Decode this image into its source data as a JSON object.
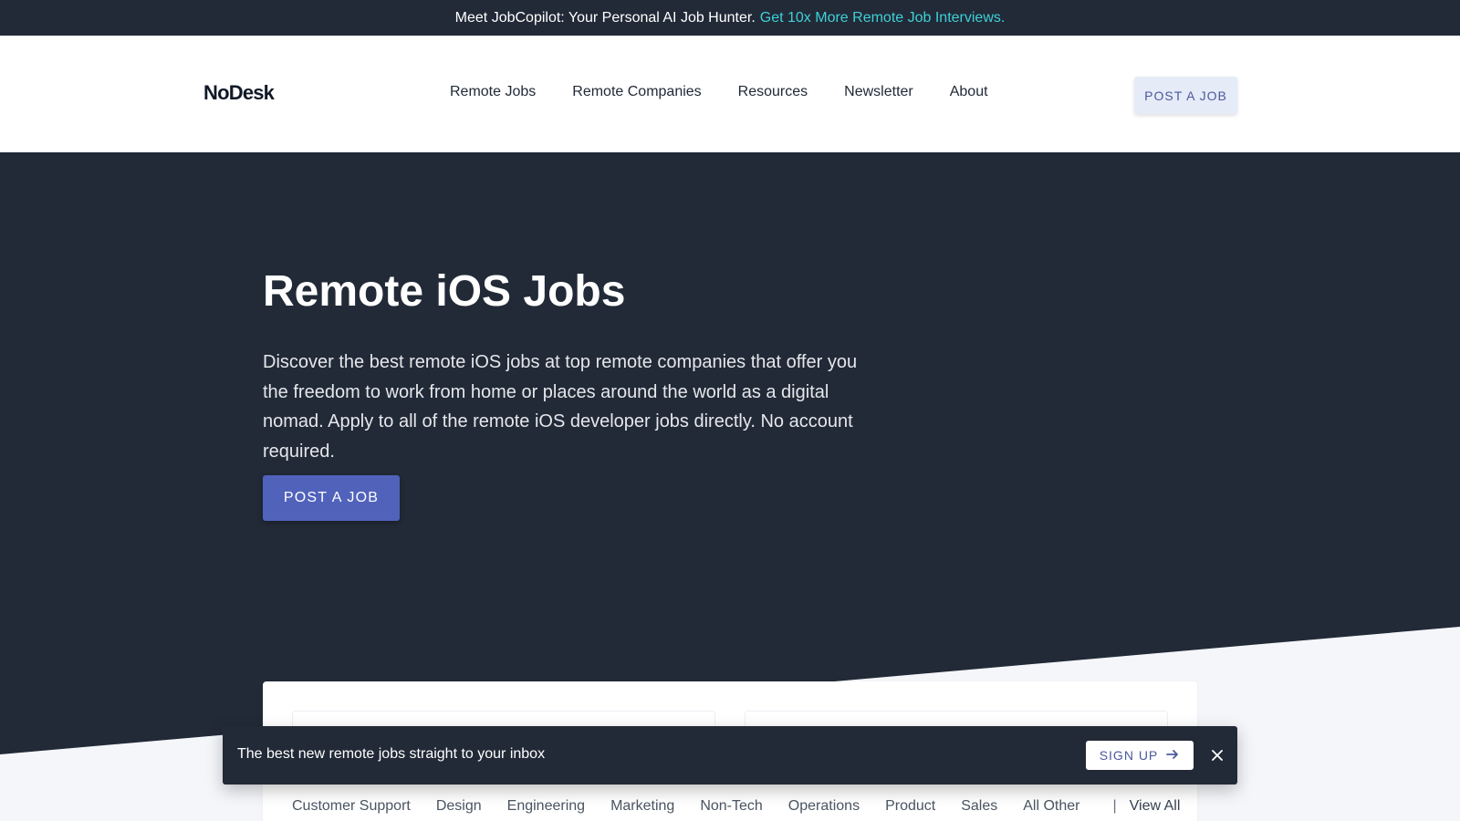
{
  "promo": {
    "text": "Meet JobCopilot: Your Personal AI Job Hunter.",
    "link": "Get 10x More Remote Job Interviews."
  },
  "header": {
    "logo": "NoDesk",
    "nav": [
      "Remote Jobs",
      "Remote Companies",
      "Resources",
      "Newsletter",
      "About"
    ],
    "post_button": "POST A JOB"
  },
  "hero": {
    "title": "Remote iOS Jobs",
    "description": "Discover the best remote iOS jobs at top remote companies that offer you the freedom to work from home or places around the world as a digital nomad. Apply to all of the remote iOS developer jobs directly. No account required.",
    "post_button": "POST A JOB"
  },
  "categories": {
    "items": [
      "Customer Support",
      "Design",
      "Engineering",
      "Marketing",
      "Non-Tech",
      "Operations",
      "Product",
      "Sales",
      "All Other"
    ],
    "separator": "|",
    "view_all": "View All"
  },
  "newsletter": {
    "text": "The best new remote jobs straight to your inbox",
    "signup_label": "SIGN UP",
    "signup_icon": "arrow-right-icon",
    "close_icon": "close-icon"
  },
  "colors": {
    "dark": "#222a37",
    "accent": "#5162bb",
    "promo_link": "#3ed0d8"
  }
}
